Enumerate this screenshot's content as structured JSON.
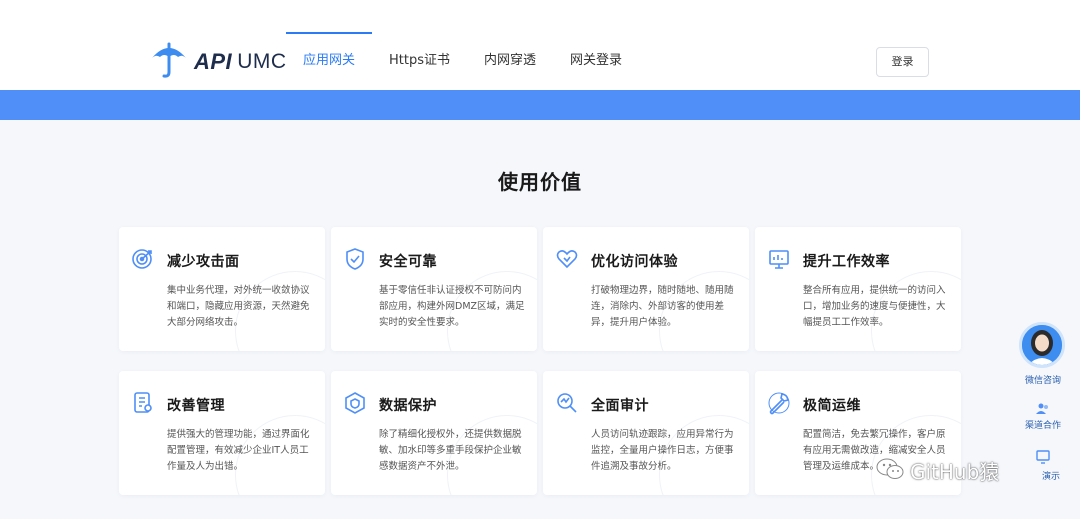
{
  "brand": {
    "logo_api": "API",
    "logo_umc": "UMC"
  },
  "nav": {
    "items": [
      {
        "label": "应用网关",
        "active": true
      },
      {
        "label": "Https证书",
        "active": false
      },
      {
        "label": "内网穿透",
        "active": false
      },
      {
        "label": "网关登录",
        "active": false
      }
    ],
    "login_label": "登录"
  },
  "section": {
    "title": "使用价值"
  },
  "cards": [
    {
      "icon": "target-icon",
      "title": "减少攻击面",
      "desc": "集中业务代理，对外统一收敛协议和端口，隐藏应用资源，天然避免大部分网络攻击。"
    },
    {
      "icon": "shield-check-icon",
      "title": "安全可靠",
      "desc": "基于零信任非认证授权不可防问内部应用，构建外网DMZ区域，满足实时的安全性要求。"
    },
    {
      "icon": "heart-hand-icon",
      "title": "优化访问体验",
      "desc": "打破物理边界，随时随地、随用随连，消除内、外部访客的使用差异，提升用户体验。"
    },
    {
      "icon": "monitor-chart-icon",
      "title": "提升工作效率",
      "desc": "整合所有应用，提供统一的访问入口，增加业务的速度与便捷性，大幅提员工工作效率。"
    },
    {
      "icon": "document-gear-icon",
      "title": "改善管理",
      "desc": "提供强大的管理功能，通过界面化配置管理，有效减少企业IT人员工作量及人为出错。"
    },
    {
      "icon": "data-shield-icon",
      "title": "数据保护",
      "desc": "除了精细化授权外，还提供数据脱敏、加水印等多重手段保护企业敏感数据资产不外泄。"
    },
    {
      "icon": "audit-search-icon",
      "title": "全面审计",
      "desc": "人员访问轨迹跟踪，应用异常行为监控，全量用户操作日志，方便事件追溯及事故分析。"
    },
    {
      "icon": "wrench-icon",
      "title": "极简运维",
      "desc": "配置简洁，免去繁冗操作，客户原有应用无需做改造，缩减安全人员管理及运维成本。"
    }
  ],
  "side_panel": {
    "wechat_label": "微信咨询",
    "channel_label": "渠道合作",
    "demo_label": "演示"
  },
  "watermark": {
    "text": "GitHub猿"
  },
  "colors": {
    "accent": "#2a7bf5",
    "banner": "#4f8ff7",
    "page_bg": "#f5f7fb",
    "icon": "#4f8ff7"
  }
}
